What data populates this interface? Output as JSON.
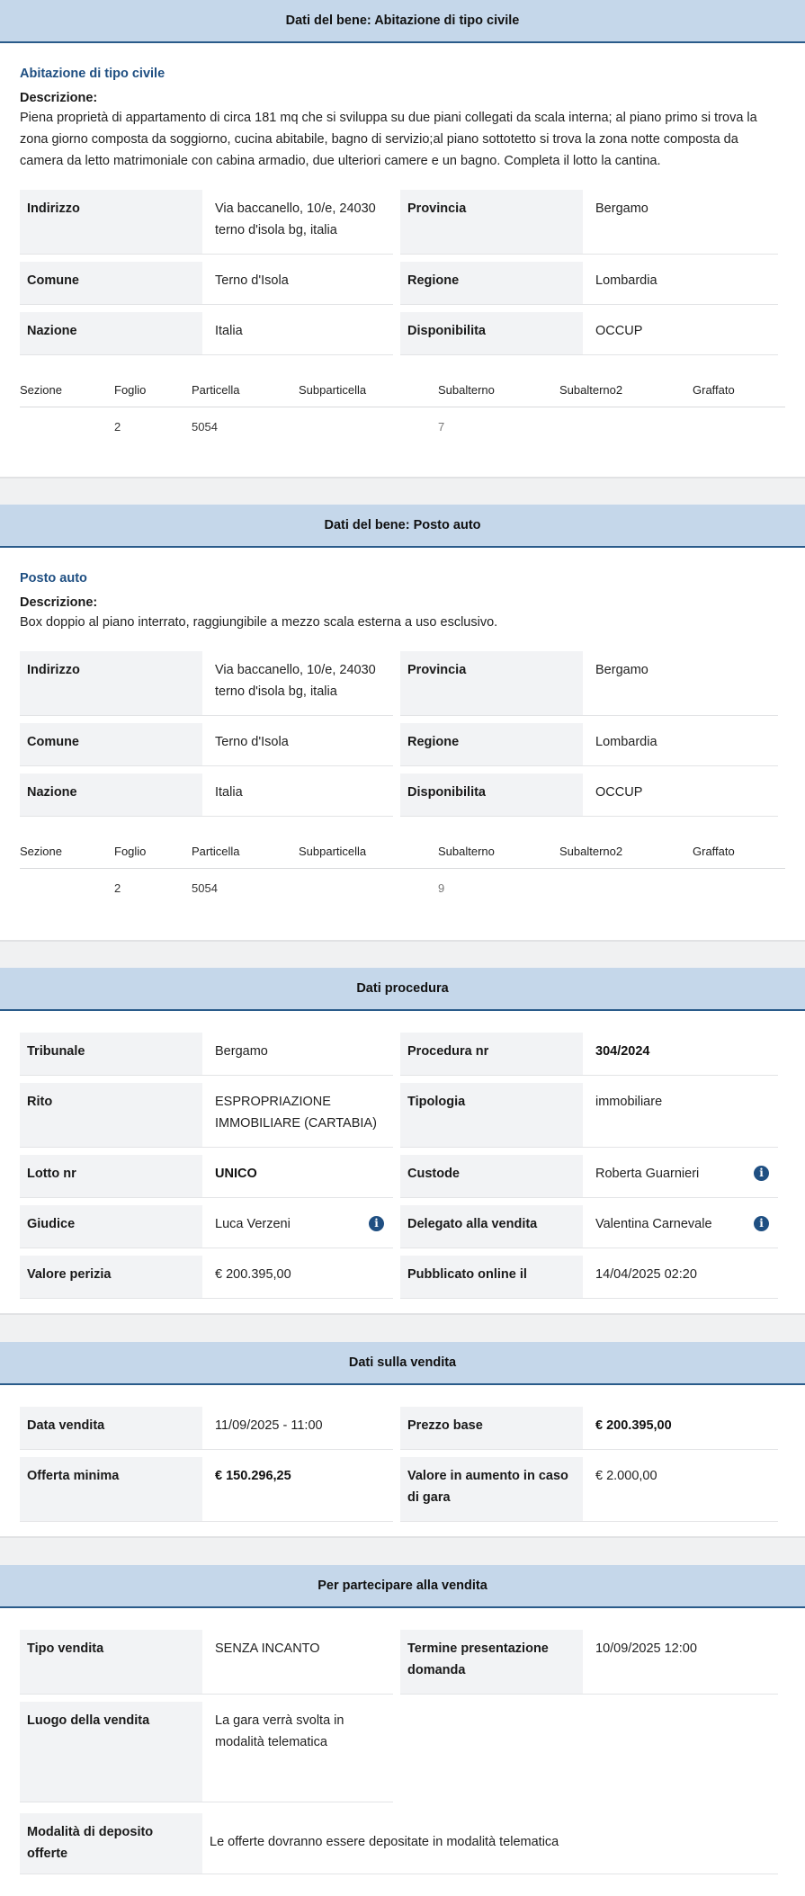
{
  "bene1": {
    "header": "Dati del bene: Abitazione di tipo civile",
    "subtitle": "Abitazione di tipo civile",
    "desc_label": "Descrizione:",
    "desc_text": "Piena proprietà di appartamento di circa 181 mq che si sviluppa su due piani collegati da scala interna; al piano primo si trova la zona giorno composta da soggiorno, cucina abitabile, bagno di servizio;al piano sottotetto si trova la zona notte composta da camera da letto matrimoniale con cabina armadio, due ulteriori camere e un bagno. Completa il lotto la cantina.",
    "indirizzo_label": "Indirizzo",
    "indirizzo_value": "Via baccanello, 10/e, 24030 terno d'isola bg, italia",
    "provincia_label": "Provincia",
    "provincia_value": "Bergamo",
    "comune_label": "Comune",
    "comune_value": "Terno d'Isola",
    "regione_label": "Regione",
    "regione_value": "Lombardia",
    "nazione_label": "Nazione",
    "nazione_value": "Italia",
    "disponibilita_label": "Disponibilita",
    "disponibilita_value": "OCCUP",
    "cad_headers": [
      "Sezione",
      "Foglio",
      "Particella",
      "Subparticella",
      "Subalterno",
      "Subalterno2",
      "Graffato"
    ],
    "cad_row": [
      "",
      "2",
      "5054",
      "",
      "7",
      "",
      ""
    ]
  },
  "bene2": {
    "header": "Dati del bene: Posto auto",
    "subtitle": "Posto auto",
    "desc_label": "Descrizione:",
    "desc_text": "Box doppio al piano interrato, raggiungibile a mezzo scala esterna a uso esclusivo.",
    "indirizzo_label": "Indirizzo",
    "indirizzo_value": "Via baccanello, 10/e, 24030 terno d'isola bg, italia",
    "provincia_label": "Provincia",
    "provincia_value": "Bergamo",
    "comune_label": "Comune",
    "comune_value": "Terno d'Isola",
    "regione_label": "Regione",
    "regione_value": "Lombardia",
    "nazione_label": "Nazione",
    "nazione_value": "Italia",
    "disponibilita_label": "Disponibilita",
    "disponibilita_value": "OCCUP",
    "cad_headers": [
      "Sezione",
      "Foglio",
      "Particella",
      "Subparticella",
      "Subalterno",
      "Subalterno2",
      "Graffato"
    ],
    "cad_row": [
      "",
      "2",
      "5054",
      "",
      "9",
      "",
      ""
    ]
  },
  "procedura": {
    "header": "Dati procedura",
    "tribunale_label": "Tribunale",
    "tribunale_value": "Bergamo",
    "procedura_label": "Procedura nr",
    "procedura_value": "304/2024",
    "rito_label": "Rito",
    "rito_value": "ESPROPRIAZIONE IMMOBILIARE (CARTABIA)",
    "tipologia_label": "Tipologia",
    "tipologia_value": "immobiliare",
    "lotto_label": "Lotto nr",
    "lotto_value": "UNICO",
    "custode_label": "Custode",
    "custode_value": "Roberta Guarnieri",
    "giudice_label": "Giudice",
    "giudice_value": "Luca Verzeni",
    "delegato_label": "Delegato alla vendita",
    "delegato_value": "Valentina Carnevale",
    "perizia_label": "Valore perizia",
    "perizia_value": "€ 200.395,00",
    "pubblicato_label": "Pubblicato online il",
    "pubblicato_value": "14/04/2025 02:20",
    "info_glyph": "i"
  },
  "vendita": {
    "header": "Dati sulla vendita",
    "data_label": "Data vendita",
    "data_value": "11/09/2025 - 11:00",
    "prezzo_label": "Prezzo base",
    "prezzo_value": "€ 200.395,00",
    "offerta_label": "Offerta minima",
    "offerta_value": "€ 150.296,25",
    "aumento_label": "Valore in aumento in caso di gara",
    "aumento_value": "€ 2.000,00"
  },
  "partecipare": {
    "header": "Per partecipare alla vendita",
    "tipo_label": "Tipo vendita",
    "tipo_value": "SENZA INCANTO",
    "termine_label": "Termine presentazione domanda",
    "termine_value": "10/09/2025 12:00",
    "luogo_label": "Luogo della vendita",
    "luogo_value": "La gara verrà svolta in modalità telematica",
    "deposito_label": "Modalità di deposito offerte",
    "deposito_value": "Le offerte dovranno essere depositate in modalità telematica"
  }
}
